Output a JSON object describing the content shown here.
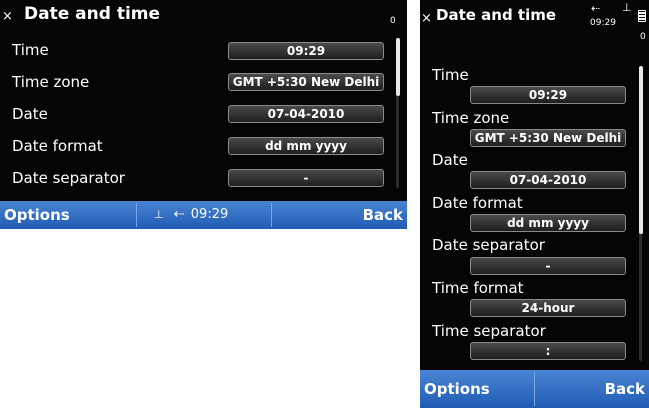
{
  "landscape": {
    "title": "Date and time",
    "close_icon": "×",
    "indicator": "0",
    "rows": [
      {
        "label": "Time",
        "value": "09:29"
      },
      {
        "label": "Time zone",
        "value": "GMT +5:30  New Delhi"
      },
      {
        "label": "Date",
        "value": "07-04-2010"
      },
      {
        "label": "Date format",
        "value": "dd mm yyyy"
      },
      {
        "label": "Date separator",
        "value": "-"
      }
    ],
    "softkeys": {
      "left": "Options",
      "right": "Back"
    },
    "status": {
      "time": "09:29",
      "usb_icon": "⇠",
      "signal_icon": "ꟷ"
    }
  },
  "portrait": {
    "title": "Date and time",
    "close_icon": "×",
    "status_time": "09:29",
    "rows": [
      {
        "label": "Time",
        "value": "09:29"
      },
      {
        "label": "Time zone",
        "value": "GMT +5:30  New Delhi"
      },
      {
        "label": "Date",
        "value": "07-04-2010"
      },
      {
        "label": "Date format",
        "value": "dd mm yyyy"
      },
      {
        "label": "Date separator",
        "value": "-"
      },
      {
        "label": "Time format",
        "value": "24-hour"
      },
      {
        "label": "Time separator",
        "value": ":"
      }
    ],
    "softkeys": {
      "left": "Options",
      "right": "Back"
    }
  }
}
